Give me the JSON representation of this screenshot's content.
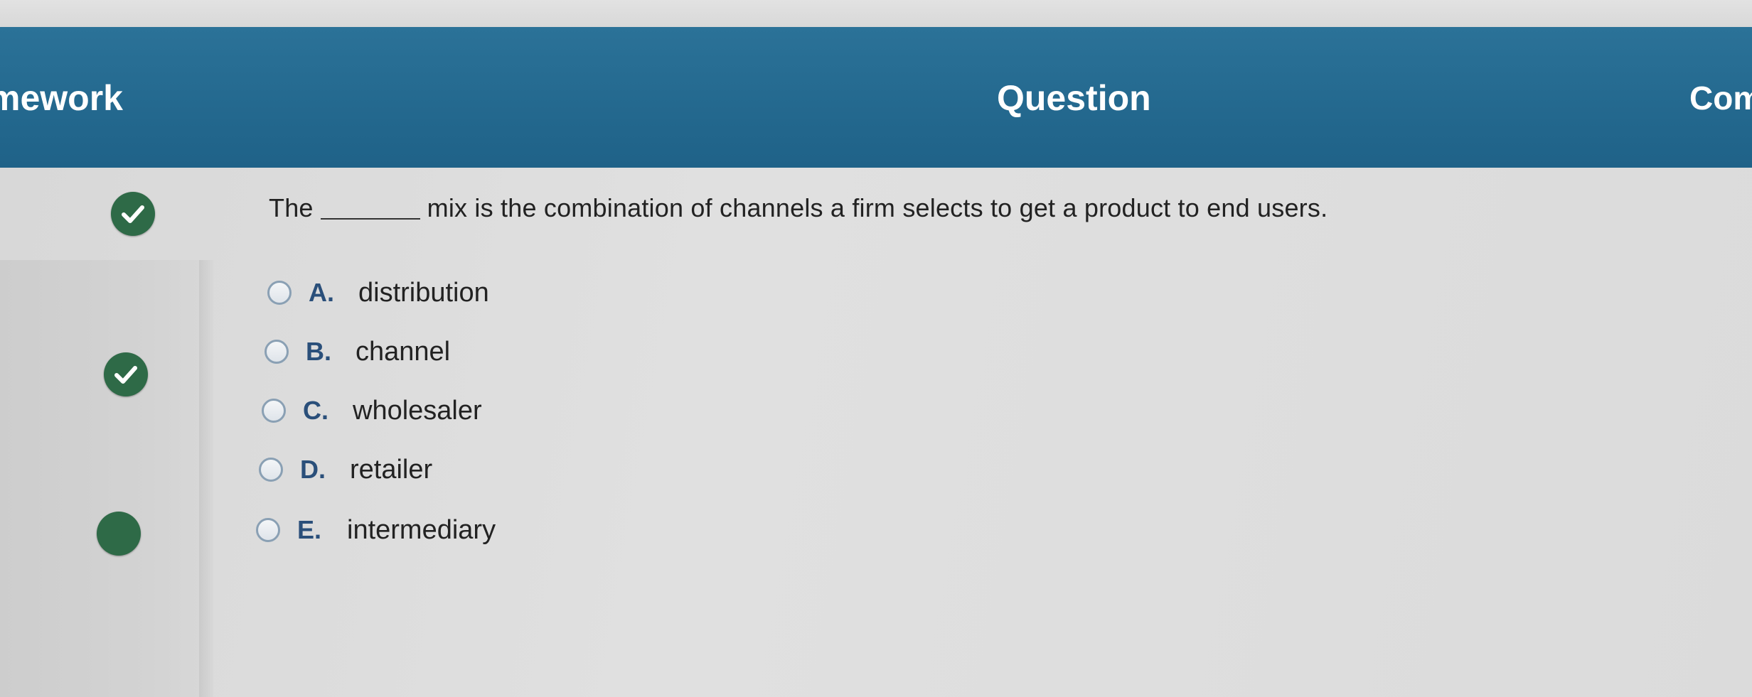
{
  "header": {
    "tab_left": "mework",
    "tab_center": "Question",
    "tab_right": "Com"
  },
  "question": {
    "before_blank": "The",
    "after_blank": "mix is the combination of channels a firm selects to get a product to end users."
  },
  "options": [
    {
      "letter": "A.",
      "text": "distribution"
    },
    {
      "letter": "B.",
      "text": "channel"
    },
    {
      "letter": "C.",
      "text": "wholesaler"
    },
    {
      "letter": "D.",
      "text": "retailer"
    },
    {
      "letter": "E.",
      "text": "intermediary"
    }
  ],
  "colors": {
    "header": "#24698f",
    "check_badge": "#2e6a47",
    "option_letter": "#2a4f7a"
  },
  "icons": {
    "radio": "radio-button-icon",
    "check": "checkmark-circle-icon"
  }
}
